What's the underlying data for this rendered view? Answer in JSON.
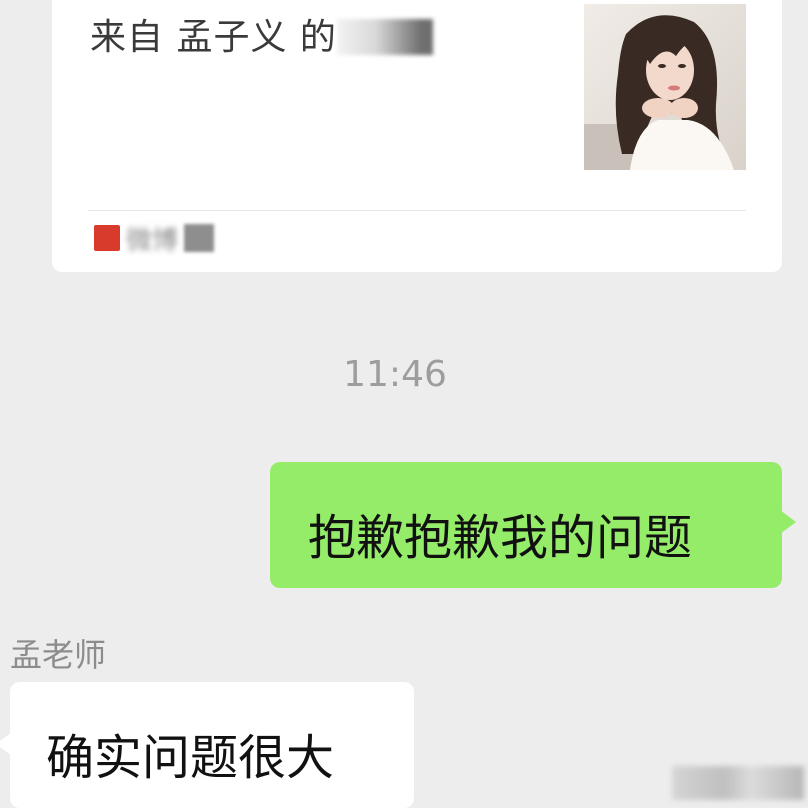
{
  "share_card": {
    "title": "来自 孟子义 的",
    "source_label": "微博"
  },
  "timestamp": "11:46",
  "messages": [
    {
      "direction": "outgoing",
      "text": "抱歉抱歉我的问题"
    },
    {
      "direction": "incoming",
      "sender": "孟老师",
      "text": "确实问题很大"
    }
  ],
  "colors": {
    "background": "#ededed",
    "outgoing_bubble": "#95ec69",
    "incoming_bubble": "#ffffff",
    "source_icon": "#d83a2c"
  }
}
